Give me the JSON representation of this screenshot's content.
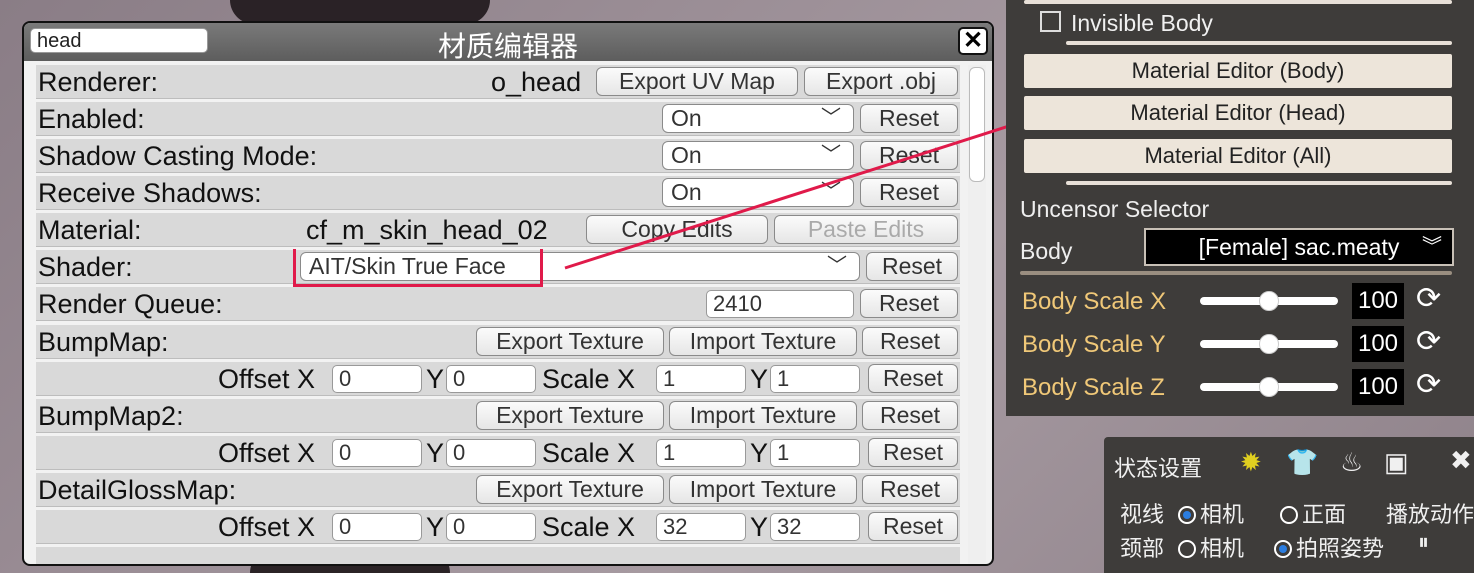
{
  "editor": {
    "title": "材质编辑器",
    "search_value": "head",
    "close": "✕",
    "renderer_label": "Renderer:",
    "renderer_value": "o_head",
    "export_uv": "Export UV Map",
    "export_obj": "Export .obj",
    "enabled_label": "Enabled:",
    "shadow_label": "Shadow Casting Mode:",
    "receive_label": "Receive Shadows:",
    "dropdown_on": "On",
    "reset": "Reset",
    "material_label": "Material:",
    "material_value": "cf_m_skin_head_02",
    "copy_edits": "Copy Edits",
    "paste_edits": "Paste Edits",
    "shader_label": "Shader:",
    "shader_value": "AIT/Skin True Face",
    "render_queue_label": "Render Queue:",
    "render_queue_value": "2410",
    "export_texture": "Export Texture",
    "import_texture": "Import Texture",
    "offset_x": "Offset X",
    "y": "Y",
    "scale_x": "Scale X",
    "bumpmap_label": "BumpMap:",
    "bumpmap2_label": "BumpMap2:",
    "detail_label": "DetailGlossMap:",
    "bump_offset": [
      "0",
      "0"
    ],
    "bump_scale": [
      "1",
      "1"
    ],
    "bump2_offset": [
      "0",
      "0"
    ],
    "bump2_scale": [
      "1",
      "1"
    ],
    "detail_offset": [
      "0",
      "0"
    ],
    "detail_scale": [
      "32",
      "32"
    ]
  },
  "right_panel": {
    "invisible_body": "Invisible Body",
    "me_body": "Material Editor (Body)",
    "me_head": "Material Editor (Head)",
    "me_all": "Material Editor (All)",
    "uncensor_selector": "Uncensor Selector",
    "body_label": "Body",
    "body_value": "[Female] sac.meaty",
    "scale_x_label": "Body Scale X",
    "scale_y_label": "Body Scale Y",
    "scale_z_label": "Body Scale Z",
    "scale_x": "100",
    "scale_y": "100",
    "scale_z": "100",
    "slider_fraction": 0.5
  },
  "status_panel": {
    "title": "状态设置",
    "gaze_label": "视线",
    "camera": "相机",
    "front": "正面",
    "play_motion": "播放动作",
    "neck_label": "颈部",
    "photo_pose": "拍照姿势"
  },
  "colors": {
    "annotation": "#e01a4a",
    "slider_label": "#f0c878",
    "radio_selected": "#2b7de0"
  }
}
